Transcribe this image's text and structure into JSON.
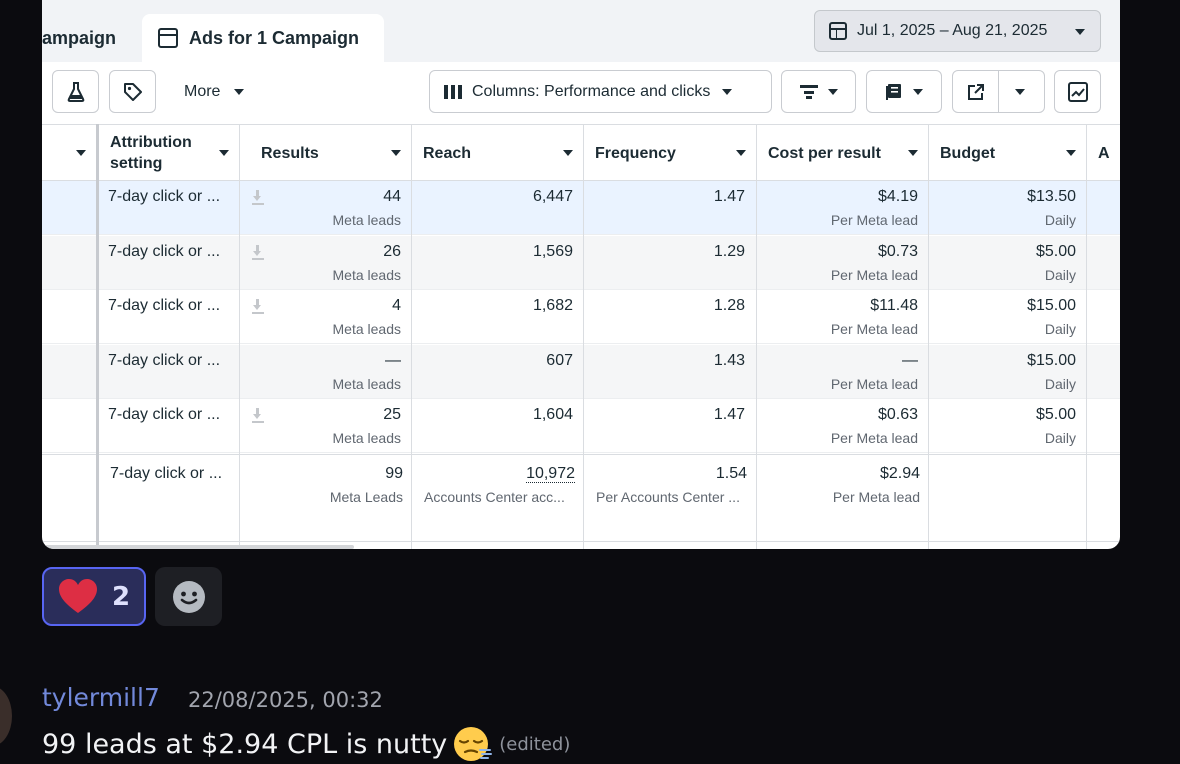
{
  "tabs": {
    "campaign_partial": "ampaign",
    "ads": "Ads for 1 Campaign"
  },
  "date_range": "Jul 1, 2025 – Aug 21, 2025",
  "toolbar": {
    "more": "More",
    "columns": "Columns: Performance and clicks"
  },
  "headers": [
    "Attribution setting",
    "Results",
    "Reach",
    "Frequency",
    "Cost per result",
    "Budget",
    "A"
  ],
  "rows": [
    {
      "attribution": "7-day click or ...",
      "results": "44",
      "results_sub": "Meta leads",
      "reach": "6,447",
      "frequency": "1.47",
      "cpr": "$4.19",
      "cpr_sub": "Per Meta lead",
      "budget": "$13.50",
      "budget_sub": "Daily",
      "download": true
    },
    {
      "attribution": "7-day click or ...",
      "results": "26",
      "results_sub": "Meta leads",
      "reach": "1,569",
      "frequency": "1.29",
      "cpr": "$0.73",
      "cpr_sub": "Per Meta lead",
      "budget": "$5.00",
      "budget_sub": "Daily",
      "download": true
    },
    {
      "attribution": "7-day click or ...",
      "results": "4",
      "results_sub": "Meta leads",
      "reach": "1,682",
      "frequency": "1.28",
      "cpr": "$11.48",
      "cpr_sub": "Per Meta lead",
      "budget": "$15.00",
      "budget_sub": "Daily",
      "download": true
    },
    {
      "attribution": "7-day click or ...",
      "results": "—",
      "results_sub": "Meta leads",
      "reach": "607",
      "frequency": "1.43",
      "cpr": "—",
      "cpr_sub": "Per Meta lead",
      "budget": "$15.00",
      "budget_sub": "Daily",
      "download": false
    },
    {
      "attribution": "7-day click or ...",
      "results": "25",
      "results_sub": "Meta leads",
      "reach": "1,604",
      "frequency": "1.47",
      "cpr": "$0.63",
      "cpr_sub": "Per Meta lead",
      "budget": "$5.00",
      "budget_sub": "Daily",
      "download": true
    }
  ],
  "totals": {
    "attribution": "7-day click or ...",
    "results": "99",
    "results_sub": "Meta Leads",
    "reach": "10,972",
    "reach_sub": "Accounts Center acc...",
    "frequency": "1.54",
    "frequency_sub": "Per Accounts Center ...",
    "cpr": "$2.94",
    "cpr_sub": "Per Meta lead"
  },
  "reaction": {
    "count": "2",
    "emoji": "red-heart",
    "color": "#5865f2"
  },
  "message": {
    "author": "tylermill7",
    "timestamp": "22/08/2025, 00:32",
    "text": "99 leads at $2.94 CPL is nutty",
    "emoji": "sleepy-face",
    "edited": "(edited)"
  }
}
